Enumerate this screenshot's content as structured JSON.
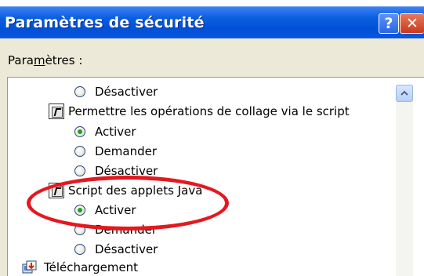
{
  "dialog": {
    "title": "Paramètres de sécurité",
    "help_button": "?",
    "close_button": "✕"
  },
  "settings": {
    "label_prefix": "Para",
    "label_accel": "m",
    "label_suffix": "ètres :",
    "items": [
      {
        "type": "radio",
        "label": "Désactiver",
        "checked": false
      },
      {
        "type": "group",
        "label": "Permettre les opérations de collage via le script",
        "icon": "script-icon"
      },
      {
        "type": "radio",
        "label": "Activer",
        "checked": true
      },
      {
        "type": "radio",
        "label": "Demander",
        "checked": false
      },
      {
        "type": "radio",
        "label": "Désactiver",
        "checked": false
      },
      {
        "type": "group",
        "label": "Script des applets Java",
        "icon": "script-icon"
      },
      {
        "type": "radio",
        "label": "Activer",
        "checked": true
      },
      {
        "type": "radio",
        "label": "Demander",
        "checked": false
      },
      {
        "type": "radio",
        "label": "Désactiver",
        "checked": false
      },
      {
        "type": "group",
        "label": "Téléchargement",
        "icon": "download-icon"
      }
    ]
  },
  "colors": {
    "titlebar": "#0a56e0",
    "dialog_bg": "#ece9d8",
    "highlight_oval": "#e4181f",
    "radio_checked": "#21a121"
  }
}
